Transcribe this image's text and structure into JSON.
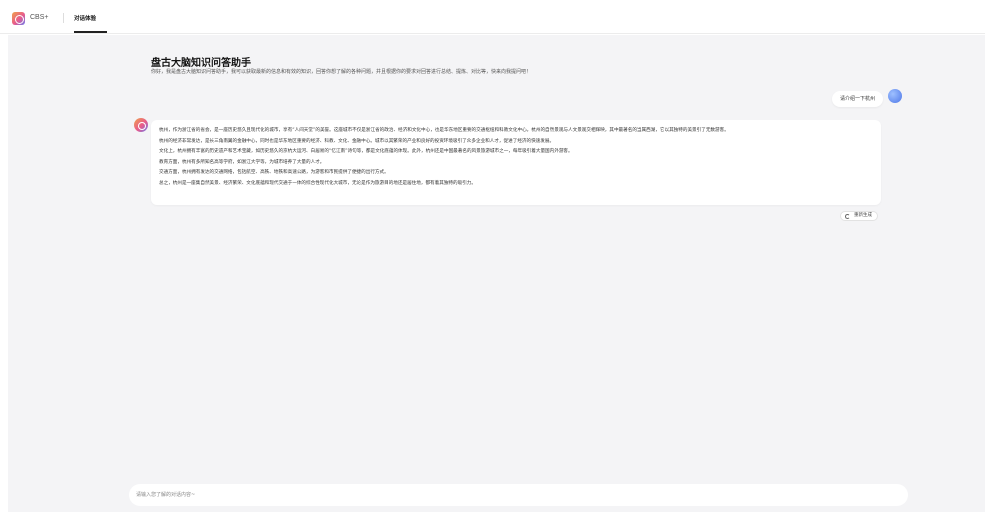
{
  "header": {
    "app_name": "CBS+",
    "tab": "对话体验"
  },
  "welcome": {
    "title": "盘古大脑知识问答助手",
    "subtitle": "你好，我是盘古大脑知识问答助手，我可以获取最新的信息和有效的知识，回答你想了解的各种问题，并且根据你的要求对回答进行总结、提炼、对比等，快来向我提问吧！"
  },
  "conversation": {
    "user_message": "请介绍一下杭州",
    "bot_lines": [
      "杭州，作为浙江省的省会，是一座历史悠久且现代化的城市，享有“人间天堂”的美誉。这座城市不仅是浙江省的政治、经济和文化中心，也是华东地区重要的交通枢纽和科教文化中心。杭州的自然景观与人文景观交相辉映，其中最著名的当属西湖，它以其独特的美景引了无数游客。",
      "杭州的经济非常发达，是长三角南翼的金融中心，同时也是华东地区重要的经济、科教、文化、金融中心。城市以其繁荣的产业和良好的投资环境吸引了众多企业和人才，促进了经济的快速发展。",
      "文化上，杭州拥有丰富的历史遗产和艺术宝藏，如历史悠久的京杭大运河、白居易的“忆江南”诗句等，都是文化底蕴的体现。此外，杭州还是中国最著名的风景旅游城市之一，每年吸引着大量国内外游客。",
      "教育方面，杭州有多所知名高等学府，如浙江大学等，为城市培养了大量的人才。",
      "交通方面，杭州拥有发达的交通网络，包括航空、高铁、地铁和高速公路，为游客和市民提供了便捷的出行方式。",
      "总之，杭州是一座集自然美景、经济繁荣、文化底蕴和现代交通于一体的综合性现代化大城市，无论是作为旅游目的地还是居住地，都有着其独特的吸引力。"
    ],
    "regenerate_label": "重新生成"
  },
  "input": {
    "placeholder": "请输入您了解的对话内容~"
  },
  "colors": {
    "page_bg": "#f4f4f6",
    "user_avatar": "#4e77e8",
    "brand_gradient": [
      "#f0a24a",
      "#e85a8c",
      "#6b7bf0"
    ]
  }
}
